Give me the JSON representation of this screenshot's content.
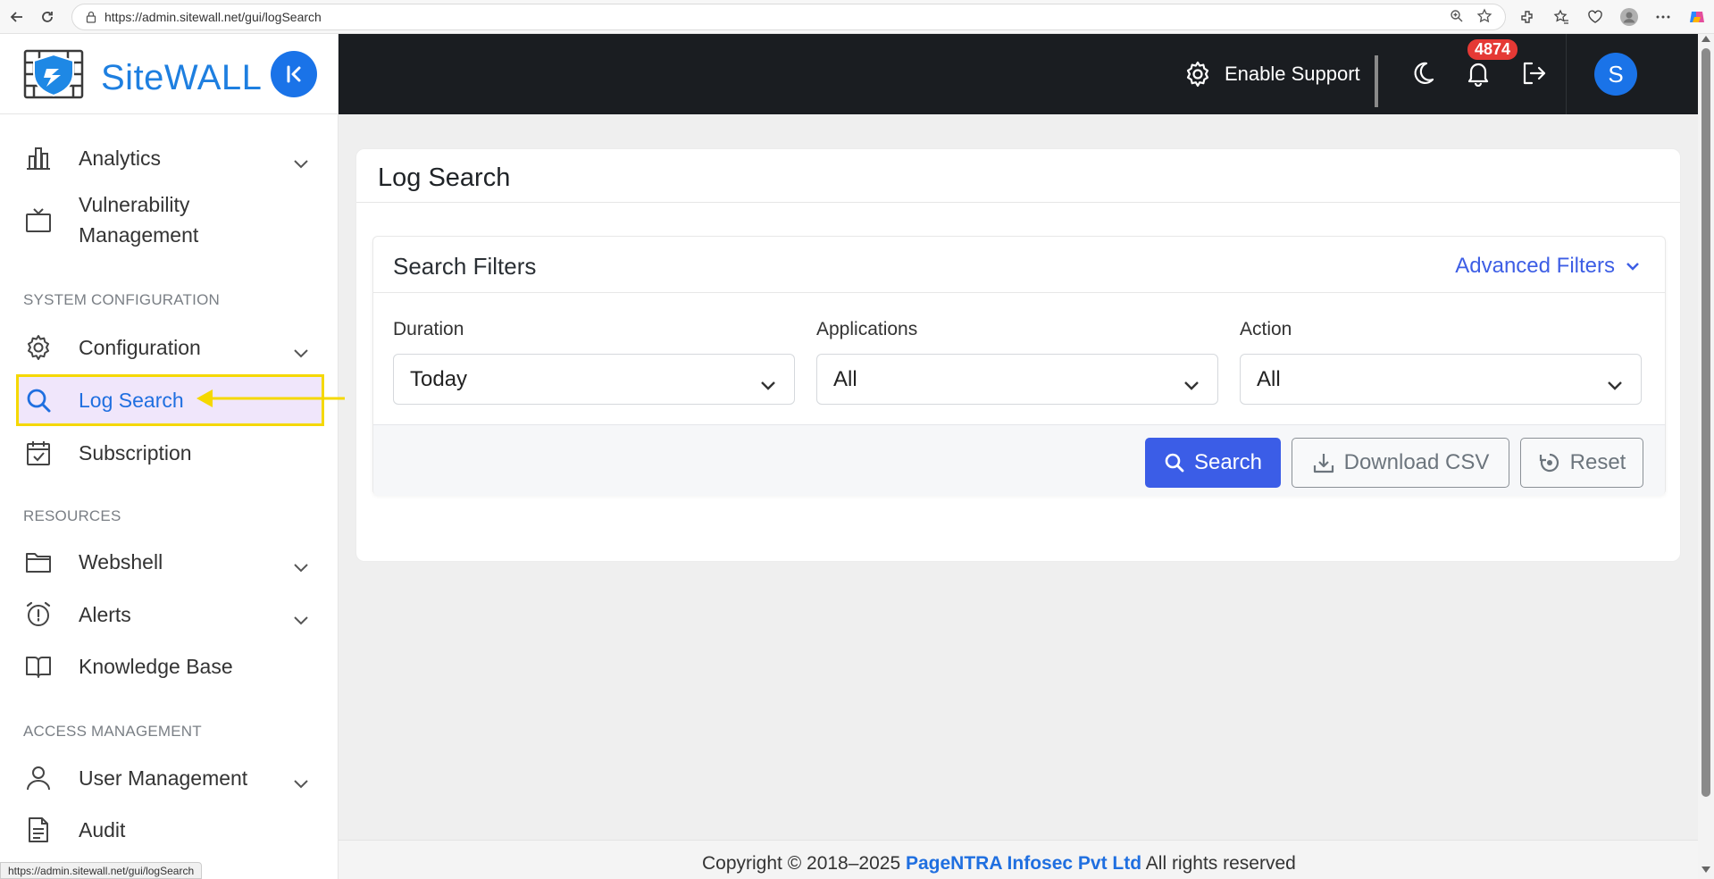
{
  "browser": {
    "url": "https://admin.sitewall.net/gui/logSearch",
    "status_url": "https://admin.sitewall.net/gui/logSearch"
  },
  "brand": {
    "name": "SiteWALL"
  },
  "sidebar": {
    "items": [
      {
        "label": "Analytics",
        "icon": "bar-chart-icon"
      },
      {
        "label_line1": "Vulnerability",
        "label_line2": "Management",
        "icon": "tv-icon"
      },
      {
        "section": "SYSTEM CONFIGURATION"
      },
      {
        "label": "Configuration",
        "icon": "gear-icon"
      },
      {
        "label": "Log Search",
        "icon": "search-icon",
        "active": true
      },
      {
        "label": "Subscription",
        "icon": "calendar-check-icon"
      },
      {
        "section": "RESOURCES"
      },
      {
        "label": "Webshell",
        "icon": "folder-icon"
      },
      {
        "label": "Alerts",
        "icon": "alarm-clock-icon"
      },
      {
        "label": "Knowledge Base",
        "icon": "book-icon"
      },
      {
        "section": "ACCESS MANAGEMENT"
      },
      {
        "label": "User Management",
        "icon": "user-icon"
      },
      {
        "label": "Audit",
        "icon": "document-icon"
      }
    ]
  },
  "header": {
    "support_label": "Enable Support",
    "notification_count": "4874",
    "avatar_initial": "S"
  },
  "main": {
    "title": "Log Search",
    "filters": {
      "title": "Search Filters",
      "advanced_label": "Advanced Filters",
      "duration": {
        "label": "Duration",
        "value": "Today"
      },
      "applications": {
        "label": "Applications",
        "value": "All"
      },
      "action": {
        "label": "Action",
        "value": "All"
      },
      "buttons": {
        "search": "Search",
        "download": "Download CSV",
        "reset": "Reset"
      }
    }
  },
  "footer": {
    "prefix": "Copyright © 2018–2025",
    "company": "PageNTRA Infosec Pvt Ltd",
    "suffix": "All rights reserved"
  },
  "colors": {
    "accent": "#1a73e8",
    "primary_button": "#3b5de7",
    "header_bg": "#1a1d21",
    "highlight_border": "#f5d800",
    "badge": "#e53935"
  }
}
